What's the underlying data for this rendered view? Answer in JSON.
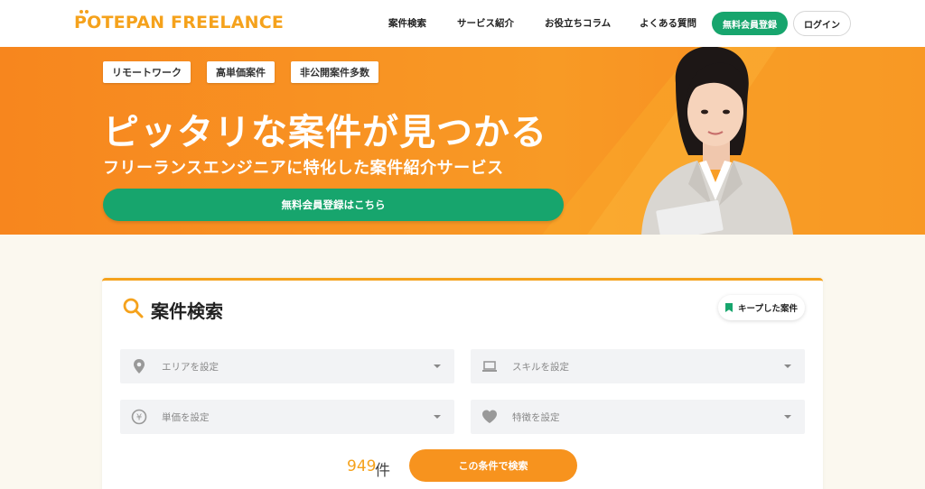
{
  "header": {
    "logo": "POTEPAN FREELANCE",
    "nav": [
      "案件検索",
      "サービス紹介",
      "お役立ちコラム",
      "よくある質問"
    ],
    "register_label": "無料会員登録",
    "login_label": "ログイン"
  },
  "hero": {
    "tags": [
      "リモートワーク",
      "高単価案件",
      "非公開案件多数"
    ],
    "title": "ピッタリな案件が見つかる",
    "subtitle": "フリーランスエンジニアに特化した案件紹介サービス",
    "cta_label": "無料会員登録はこちら"
  },
  "search": {
    "title": "案件検索",
    "keep_label": "キープした案件",
    "filters": [
      {
        "label": "エリアを設定",
        "icon": "location-pin-icon"
      },
      {
        "label": "スキルを設定",
        "icon": "laptop-icon"
      },
      {
        "label": "単価を設定",
        "icon": "yen-icon"
      },
      {
        "label": "特徴を設定",
        "icon": "heart-icon"
      }
    ],
    "result_count": "949",
    "result_unit": "件",
    "submit_label": "この条件で検索"
  },
  "colors": {
    "brand_orange": "#f7861e",
    "accent_green": "#17a56d",
    "logo_yellow": "#f5a21c"
  }
}
